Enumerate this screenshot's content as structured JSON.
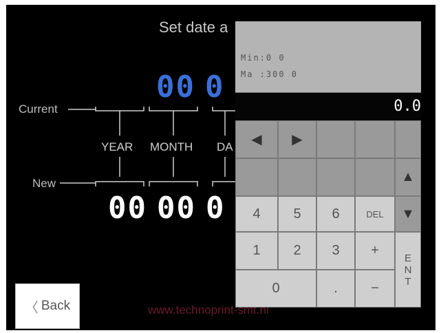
{
  "screen": {
    "title": "Set date a",
    "current_label": "Current",
    "new_label": "New",
    "columns": [
      "YEAR",
      "MONTH",
      "DA"
    ],
    "current_digits": [
      "00",
      "0"
    ],
    "new_digits": [
      "00",
      "00",
      "0"
    ],
    "back_label": "Back",
    "url_text": "www.technoprint-smt.nl",
    "colors": {
      "current_digits": "#3b6fd8",
      "new_digits": "#ffffff",
      "url": "#6b1a2a"
    }
  },
  "keypad": {
    "min_text": "Min:0 0",
    "max_text": "Ma :300 0",
    "display_value": "0.0",
    "left_arrow": "◀",
    "right_arrow": "▶",
    "up_arrow": "▲",
    "down_arrow": "▼",
    "keys": {
      "k4": "4",
      "k5": "5",
      "k6": "6",
      "del": "DEL",
      "k1": "1",
      "k2": "2",
      "k3": "3",
      "plus": "+",
      "k0": "0",
      "dot": ".",
      "minus": "−"
    },
    "ent": [
      "E",
      "N",
      "T"
    ]
  }
}
